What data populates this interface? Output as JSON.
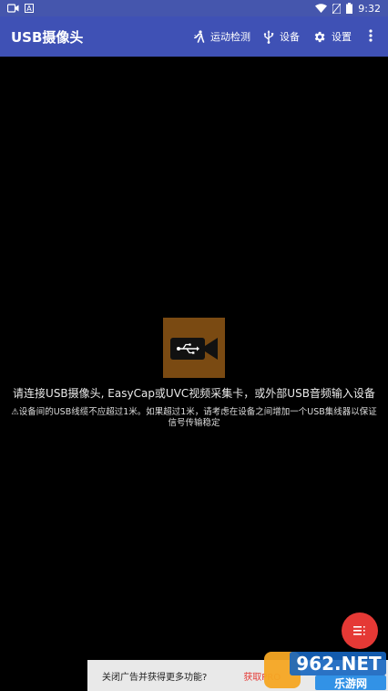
{
  "status_bar": {
    "time": "9:32",
    "left_icons": [
      "cast-icon",
      "a-icon"
    ],
    "right_icons": [
      "wifi-icon",
      "no-sim-icon",
      "battery-icon"
    ]
  },
  "app_bar": {
    "title": "USB摄像头",
    "actions": [
      {
        "label": "运动检测",
        "icon": "motion-detect-icon"
      },
      {
        "label": "设备",
        "icon": "usb-icon"
      },
      {
        "label": "设置",
        "icon": "gear-icon"
      }
    ],
    "overflow_icon": "more-vert-icon",
    "color": "#3f51b5"
  },
  "main": {
    "placeholder_icon": "usb-camera-icon",
    "connect_message": "请连接USB摄像头, EasyCap或UVC视频采集卡，或外部USB音频输入设备",
    "warning_message": "⚠设备间的USB线缆不应超过1米。如果超过1米，请考虑在设备之间增加一个USB集线器以保证信号传输稳定"
  },
  "fab": {
    "icon": "menu-list-icon",
    "color": "#e53935"
  },
  "ad_bar": {
    "text": "关闭广告并获得更多功能?",
    "link": "获取PRO"
  },
  "watermark": {
    "text": "962.NET",
    "subtext": "乐游网"
  }
}
